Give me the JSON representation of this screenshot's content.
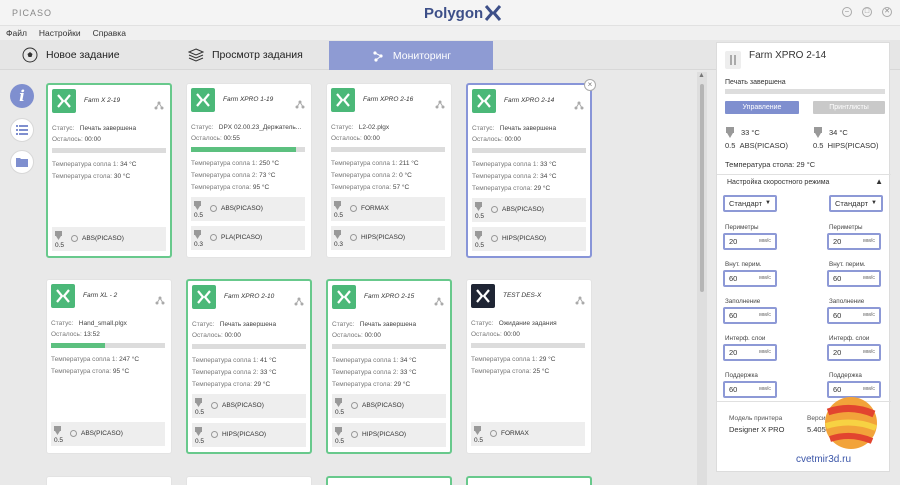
{
  "window": {
    "app_name": "PICASO",
    "logo_text": "Polygon",
    "controls": [
      "–",
      "□",
      "✕"
    ]
  },
  "menu": [
    "Файл",
    "Настройки",
    "Справка"
  ],
  "tabs": [
    {
      "label": "Новое задание",
      "icon": "soccer-ball-icon"
    },
    {
      "label": "Просмотр задания",
      "icon": "layers-icon"
    },
    {
      "label": "Мониторинг",
      "icon": "network-icon",
      "active": true
    }
  ],
  "labels": {
    "status": "Статус:",
    "remaining": "Осталось:",
    "t_nozzle1": "Температура сопла 1:",
    "t_nozzle2": "Температура сопла 2:",
    "t_bed": "Температура стола:"
  },
  "cards": [
    {
      "name": "Farm X 2-19",
      "status": "Печать завершена",
      "remaining": "00:00",
      "progress": 0,
      "t1": "34 °C",
      "t2": null,
      "bed": "30 °C",
      "extruders": [
        {
          "size": "0.5",
          "material": "ABS(PICASO)"
        }
      ]
    },
    {
      "name": "Farm XPRO 1-19",
      "status": "DPX 02.00.23_Держатель...",
      "remaining": "00:55",
      "progress": 92,
      "t1": "250 °C",
      "t2": "73 °C",
      "bed": "95 °C",
      "extruders": [
        {
          "size": "0.5",
          "material": "ABS(PICASO)"
        },
        {
          "size": "0.3",
          "material": "PLA(PICASO)"
        }
      ]
    },
    {
      "name": "Farm XPRO 2-16",
      "status": "L2-02.plgx",
      "remaining": "00:00",
      "progress": 0,
      "t1": "211 °C",
      "t2": "0 °C",
      "bed": "57 °C",
      "extruders": [
        {
          "size": "0.5",
          "material": "FORMAX"
        },
        {
          "size": "0.3",
          "material": "HIPS(PICASO)"
        }
      ]
    },
    {
      "name": "Farm XPRO 2-14",
      "status": "Печать завершена",
      "remaining": "00:00",
      "progress": 0,
      "t1": "33 °C",
      "t2": "34 °C",
      "bed": "29 °C",
      "extruders": [
        {
          "size": "0.5",
          "material": "ABS(PICASO)"
        },
        {
          "size": "0.5",
          "material": "HIPS(PICASO)"
        }
      ]
    },
    {
      "name": "Farm XL - 2",
      "status": "Hand_small.plgx",
      "remaining": "13:52",
      "progress": 47,
      "t1": "247 °C",
      "t2": null,
      "bed": "95 °C",
      "extruders": [
        {
          "size": "0.5",
          "material": "ABS(PICASO)"
        }
      ]
    },
    {
      "name": "Farm XPRO 2-10",
      "status": "Печать завершена",
      "remaining": "00:00",
      "progress": 0,
      "t1": "41 °C",
      "t2": "33 °C",
      "bed": "29 °C",
      "extruders": [
        {
          "size": "0.5",
          "material": "ABS(PICASO)"
        },
        {
          "size": "0.5",
          "material": "HIPS(PICASO)"
        }
      ]
    },
    {
      "name": "Farm XPRO 2-15",
      "status": "Печать завершена",
      "remaining": "00:00",
      "progress": 0,
      "t1": "34 °C",
      "t2": "33 °C",
      "bed": "29 °C",
      "extruders": [
        {
          "size": "0.5",
          "material": "ABS(PICASO)"
        },
        {
          "size": "0.5",
          "material": "HIPS(PICASO)"
        }
      ]
    },
    {
      "name": "TEST DES-X",
      "status": "Ожидание задания",
      "remaining": "00:00",
      "progress": 0,
      "t1": "29 °C",
      "t2": null,
      "bed": "25 °C",
      "extruders": [
        {
          "size": "0.5",
          "material": "FORMAX"
        }
      ]
    }
  ],
  "panel": {
    "title": "Farm XPRO 2-14",
    "status": "Печать завершена",
    "manage_label": "Управление",
    "profiles_label": "Принтлисты",
    "ext1_temp": "33 °C",
    "ext1_size": "0.5",
    "ext1_material": "ABS(PICASO)",
    "ext2_temp": "34 °C",
    "ext2_size": "0.5",
    "ext2_material": "HIPS(PICASO)",
    "bed": "Температура стола: 29 °C",
    "speed_title": "Настройка скоростного режима",
    "mode_left": "Стандарт",
    "mode_right": "Стандарт",
    "unit": "мм/с",
    "fields": [
      {
        "label": "Периметры",
        "left": "20",
        "right": "20"
      },
      {
        "label": "Внут. перим.",
        "left": "60",
        "right": "60"
      },
      {
        "label": "Заполнение",
        "left": "60",
        "right": "60"
      },
      {
        "label": "Интерф. слои",
        "left": "20",
        "right": "20"
      },
      {
        "label": "Поддержка",
        "left": "60",
        "right": "60"
      }
    ],
    "model_label": "Модель принтера",
    "model": "Designer X PRO",
    "version_label": "Версия",
    "version": "5.405"
  },
  "watermark": "cvetmir3d.ru",
  "colors": {
    "accent": "#7f8fcf",
    "done_border": "#68c98c",
    "icon_green": "#4bb878"
  }
}
